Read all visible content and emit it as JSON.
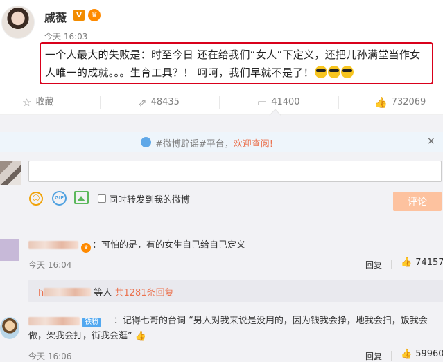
{
  "post": {
    "author": "戚薇",
    "verified_badge": "V",
    "member_badge": "♛",
    "time": "今天 16:03",
    "content": "一个人最大的失败是：时至今日 还在给我们“女人”下定义，还把儿孙满堂当作女人唯一的成就。。。生育工具？！ 呵呵，我们早就不是了！",
    "emojis": [
      "cool-sunglasses-emoji",
      "cool-sunglasses-emoji",
      "cool-sunglasses-emoji"
    ]
  },
  "actions": {
    "favorite": {
      "label": "收藏",
      "icon": "star-icon"
    },
    "repost": {
      "count": "48435",
      "icon": "repost-icon"
    },
    "comment": {
      "count": "41400",
      "icon": "comment-icon"
    },
    "like": {
      "count": "732069",
      "icon": "thumbs-up-icon"
    }
  },
  "notice": {
    "text": "#微博辟谣#平台，",
    "link": "欢迎查阅!",
    "close": "×"
  },
  "composer": {
    "repost_label": "同时转发到我的微博",
    "submit_label": "评论",
    "gif_label": "GIF"
  },
  "comments": [
    {
      "text": "：可怕的是，有的女生自己给自己定义",
      "time": "今天 16:04",
      "reply_label": "回复",
      "likes": "74157"
    },
    {
      "fan_badge": "铁粉",
      "text": "：记得七哥的台词 “男人对我来说是没用的，因为钱我会挣，地我会扫，饭我会做，架我会打，街我会逛” 👍",
      "time": "今天 16:06",
      "reply_label": "回复",
      "likes": "59960"
    }
  ],
  "subreplies": {
    "user_prefix": "h",
    "suffix": " 等人 ",
    "count_text": "共1281条回复"
  },
  "colors": {
    "highlight_border": "#d9001b",
    "accent_orange": "#eb7350",
    "submit_button": "#fdc29f",
    "comments_bg": "#f2f2f5"
  }
}
